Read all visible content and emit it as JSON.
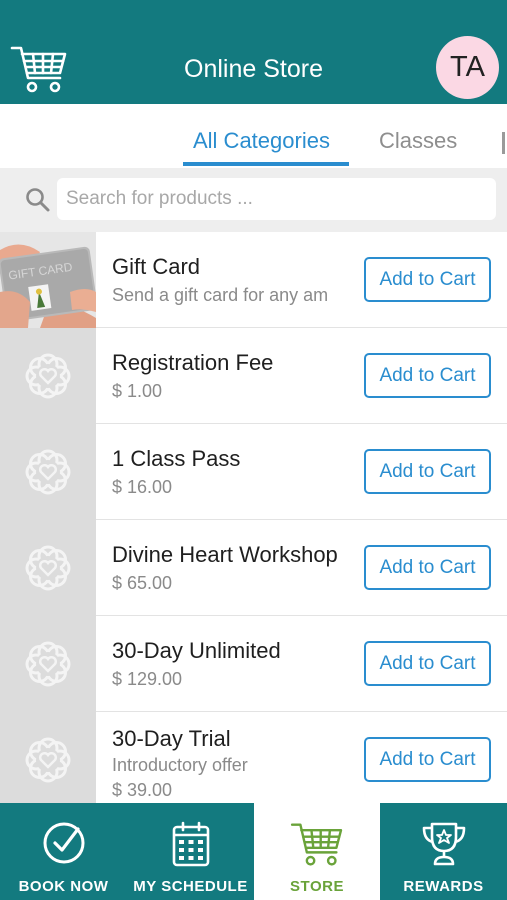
{
  "header": {
    "title": "Online Store",
    "avatar_initials": "TA"
  },
  "tabs": [
    {
      "label": "All Categories",
      "active": true
    },
    {
      "label": "Classes",
      "active": false
    }
  ],
  "search": {
    "placeholder": "Search for products ..."
  },
  "products": [
    {
      "name": "Gift Card",
      "subtitle": "Send a gift card for any am",
      "button": "Add to Cart",
      "thumbnail": "gift-card-photo"
    },
    {
      "name": "Registration Fee",
      "subtitle": "$ 1.00",
      "button": "Add to Cart",
      "thumbnail": "placeholder-logo"
    },
    {
      "name": "1 Class Pass",
      "subtitle": "$ 16.00",
      "button": "Add to Cart",
      "thumbnail": "placeholder-logo"
    },
    {
      "name": "Divine Heart Workshop",
      "subtitle": "$ 65.00",
      "button": "Add to Cart",
      "thumbnail": "placeholder-logo"
    },
    {
      "name": "30-Day Unlimited",
      "subtitle": "$ 129.00",
      "button": "Add to Cart",
      "thumbnail": "placeholder-logo"
    },
    {
      "name": "30-Day Trial",
      "subtitle": "Introductory offer",
      "subtitle2": "$ 39.00",
      "button": "Add to Cart",
      "thumbnail": "placeholder-logo"
    }
  ],
  "giftcard_image_text": "GIFT CARD",
  "bottom_nav": [
    {
      "label": "BOOK NOW",
      "icon": "check-circle-icon",
      "active": false
    },
    {
      "label": "MY SCHEDULE",
      "icon": "calendar-icon",
      "active": false
    },
    {
      "label": "STORE",
      "icon": "cart-icon",
      "active": true
    },
    {
      "label": "REWARDS",
      "icon": "trophy-icon",
      "active": false
    }
  ],
  "colors": {
    "brand_teal": "#137a7f",
    "accent_blue": "#2a8dcf",
    "active_green": "#6aa33a",
    "avatar_pink": "#fbd8e4"
  }
}
